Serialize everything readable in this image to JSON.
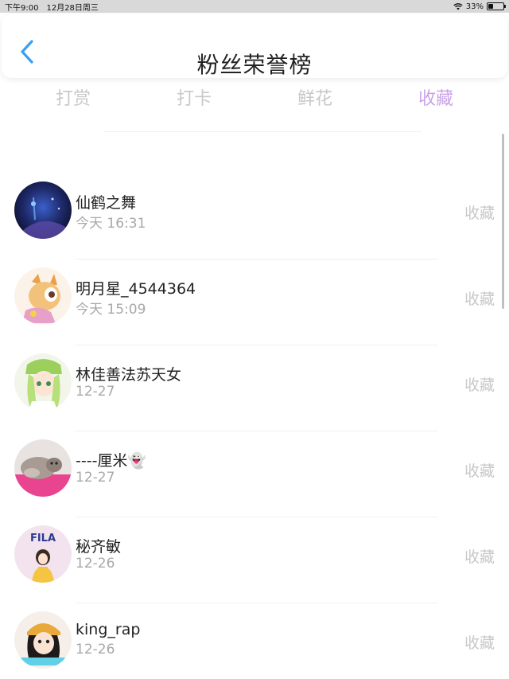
{
  "status_bar": {
    "time": "下午9:00",
    "date": "12月28日周三",
    "battery": "33%",
    "battery_level": 0.33
  },
  "header": {
    "title": "粉丝荣誉榜",
    "back_icon": "chevron-left-icon"
  },
  "tabs": [
    {
      "label": "打赏",
      "active": false
    },
    {
      "label": "打卡",
      "active": false
    },
    {
      "label": "鲜花",
      "active": false
    },
    {
      "label": "收藏",
      "active": true
    }
  ],
  "colors": {
    "accent": "#c9a3e6",
    "back_icon": "#3a9ef0",
    "inactive_text": "#c8c8c8"
  },
  "fans": [
    {
      "name": "仙鹤之舞",
      "time": "今天 16:31",
      "action": "收藏"
    },
    {
      "name": "明月星_4544364",
      "time": "今天 15:09",
      "action": "收藏"
    },
    {
      "name": "林佳善法苏天女",
      "time": "12-27",
      "action": "收藏"
    },
    {
      "name": "----厘米👻",
      "time": "12-27",
      "action": "收藏"
    },
    {
      "name": "秘齐敏",
      "time": "12-26",
      "action": "收藏"
    },
    {
      "name": "king_rap",
      "time": "12-26",
      "action": "收藏"
    }
  ],
  "avatar_badges": {
    "fila": "FILA"
  }
}
